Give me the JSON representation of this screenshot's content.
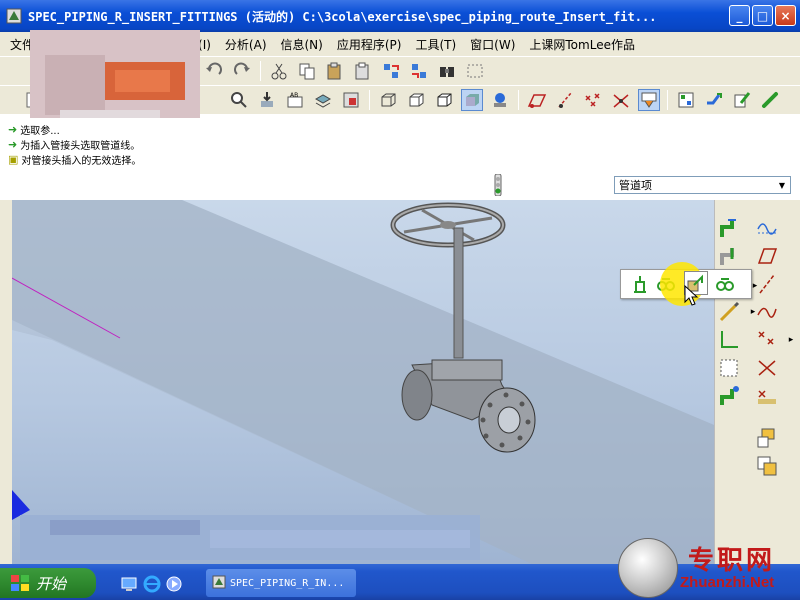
{
  "window": {
    "title": "SPEC_PIPING_R_INSERT_FITTINGS (活动的) C:\\3cola\\exercise\\spec_piping_route_Insert_fit...",
    "minimize": "_",
    "maximize": "□",
    "close": "×"
  },
  "menu": {
    "items": [
      "文件",
      "入(I)",
      "分析(A)",
      "信息(N)",
      "应用程序(P)",
      "工具(T)",
      "窗口(W)",
      "上课网TomLee作品"
    ]
  },
  "messages": [
    "选取参...",
    "为插入管接头选取管道线。",
    "对管接头插入的无效选择。"
  ],
  "filter": {
    "selected": "管道项"
  },
  "taskbar": {
    "start_label": "开始",
    "task_label": "SPEC_PIPING_R_IN..."
  },
  "watermark": {
    "brand": "专职网",
    "url": "Zhuanzhi.Net"
  },
  "colors": {
    "titlebar": "#0a4fd6",
    "chrome": "#ece9d8",
    "viewport": "#b6c8e0",
    "highlight": "#ffe600"
  }
}
